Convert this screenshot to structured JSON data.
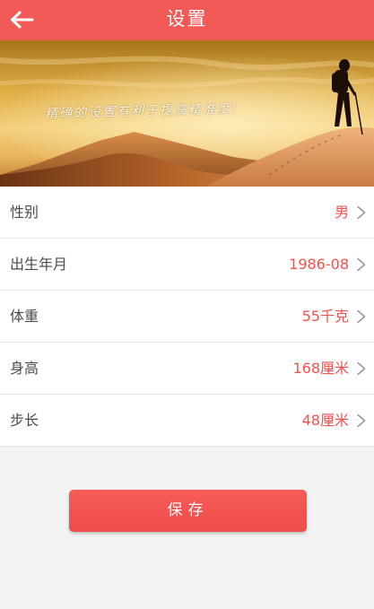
{
  "header": {
    "title": "设置",
    "back_icon": "arrow-left-icon"
  },
  "banner": {
    "slogan": "精确的设置有利于提高精准度!"
  },
  "settings": [
    {
      "label": "性别",
      "value": "男"
    },
    {
      "label": "出生年月",
      "value": "1986-08"
    },
    {
      "label": "体重",
      "value": "55千克"
    },
    {
      "label": "身高",
      "value": "168厘米"
    },
    {
      "label": "步长",
      "value": "48厘米"
    }
  ],
  "actions": {
    "save_label": "保存"
  },
  "colors": {
    "accent": "#f25a57",
    "value_text": "#f2524f",
    "background": "#f2f2f2"
  }
}
